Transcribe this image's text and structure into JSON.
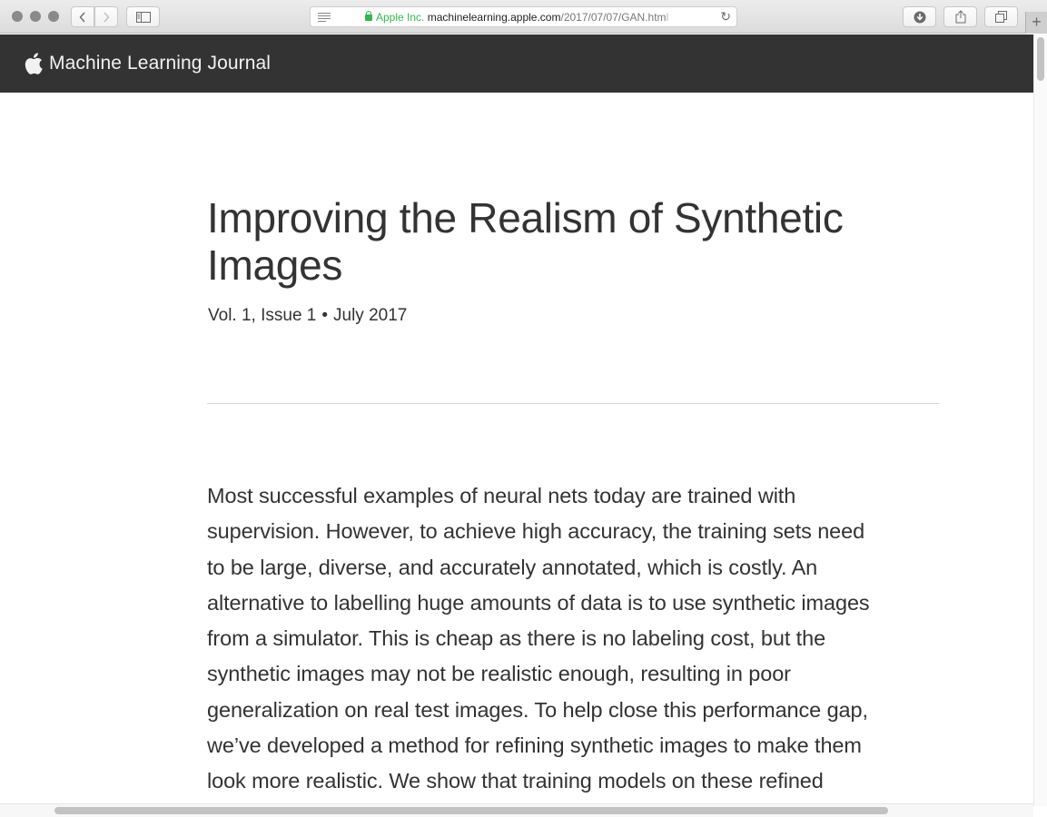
{
  "browser": {
    "url": {
      "org": "Apple Inc.",
      "domain": "machinelearning.apple.com",
      "path": "/2017/07/07/GAN.htm",
      "fade": "l"
    },
    "new_tab_label": "+"
  },
  "site": {
    "name": "Machine Learning Journal"
  },
  "article": {
    "title": "Improving the Realism of Synthetic Images",
    "volume": "Vol. 1, Issue 1",
    "separator": "•",
    "date": "July 2017",
    "body_lines": [
      "Most successful examples of neural nets today are trained with",
      "supervision. However, to achieve high accuracy, the training sets need",
      "to be large, diverse, and accurately annotated, which is costly. An",
      "alternative to labelling huge amounts of data is to use synthetic images",
      "from a simulator. This is cheap as there is no labeling cost, but the",
      "synthetic images may not be realistic enough, resulting in poor",
      "generalization on real test images. To help close this performance gap,",
      "we’ve developed a method for refining synthetic images to make them",
      "look more realistic. We show that training models on these refined"
    ]
  },
  "colors": {
    "header_bg": "#333333",
    "secure_green": "#2cbb4b",
    "text": "#333333"
  }
}
